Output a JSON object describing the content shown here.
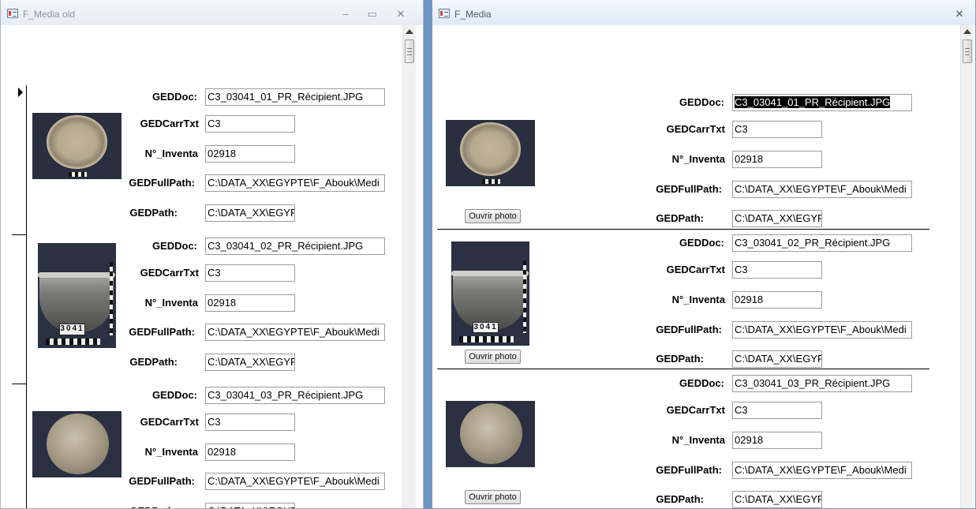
{
  "windows": {
    "old": {
      "title": "F_Media old"
    },
    "new": {
      "title": "F_Media"
    }
  },
  "labels": {
    "ged_doc": "GEDDoc:",
    "ged_carr_txt": "GEDCarrTxt",
    "n_inventaire": "N°_Inventa",
    "ged_full_path": "GEDFullPath:",
    "ged_path": "GEDPath:"
  },
  "button": {
    "open_photo": "Ouvrir photo"
  },
  "photo_tag": "3041",
  "records": [
    {
      "doc": "C3_03041_01_PR_Récipient.JPG",
      "carr": "C3",
      "inv": "02918",
      "full_path": "C:\\DATA_XX\\EGYPTE\\F_Abouk\\Medi",
      "path": "C:\\DATA_XX\\EGYP"
    },
    {
      "doc": "C3_03041_02_PR_Récipient.JPG",
      "carr": "C3",
      "inv": "02918",
      "full_path": "C:\\DATA_XX\\EGYPTE\\F_Abouk\\Medi",
      "path": "C:\\DATA_XX\\EGYP"
    },
    {
      "doc": "C3_03041_03_PR_Récipient.JPG",
      "carr": "C3",
      "inv": "02918",
      "full_path": "C:\\DATA_XX\\EGYPTE\\F_Abouk\\Medi",
      "path": "C:\\DATA_XX\\EGYP"
    }
  ]
}
